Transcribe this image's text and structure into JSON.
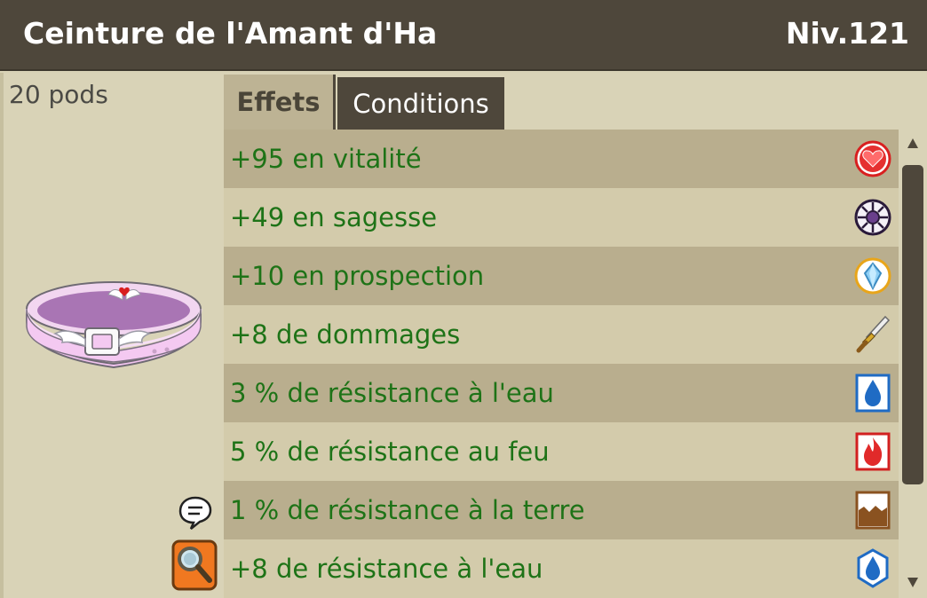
{
  "item": {
    "name": "Ceinture de l'Amant d'Ha",
    "level": "Niv.121",
    "weight": "20 pods"
  },
  "tabs": {
    "effects": "Effets",
    "conditions": "Conditions",
    "active": "Effets"
  },
  "effects": [
    {
      "label": "+95 en vitalité",
      "icon": "vitality-icon"
    },
    {
      "label": "+49 en sagesse",
      "icon": "wisdom-icon"
    },
    {
      "label": "+10 en prospection",
      "icon": "prospecting-icon"
    },
    {
      "label": "+8 de dommages",
      "icon": "damage-icon"
    },
    {
      "label": "3 % de résistance à l'eau",
      "icon": "water-resistance-icon"
    },
    {
      "label": "5 % de résistance au feu",
      "icon": "fire-resistance-icon"
    },
    {
      "label": "1 % de résistance à la terre",
      "icon": "earth-resistance-icon"
    },
    {
      "label": "+8 de résistance à l'eau",
      "icon": "water-resistance-icon"
    }
  ],
  "colors": {
    "header": "#4e473b",
    "effect_text": "#1e7317",
    "row_dark": "#b9ae8e",
    "row_light": "#d3cbab"
  }
}
